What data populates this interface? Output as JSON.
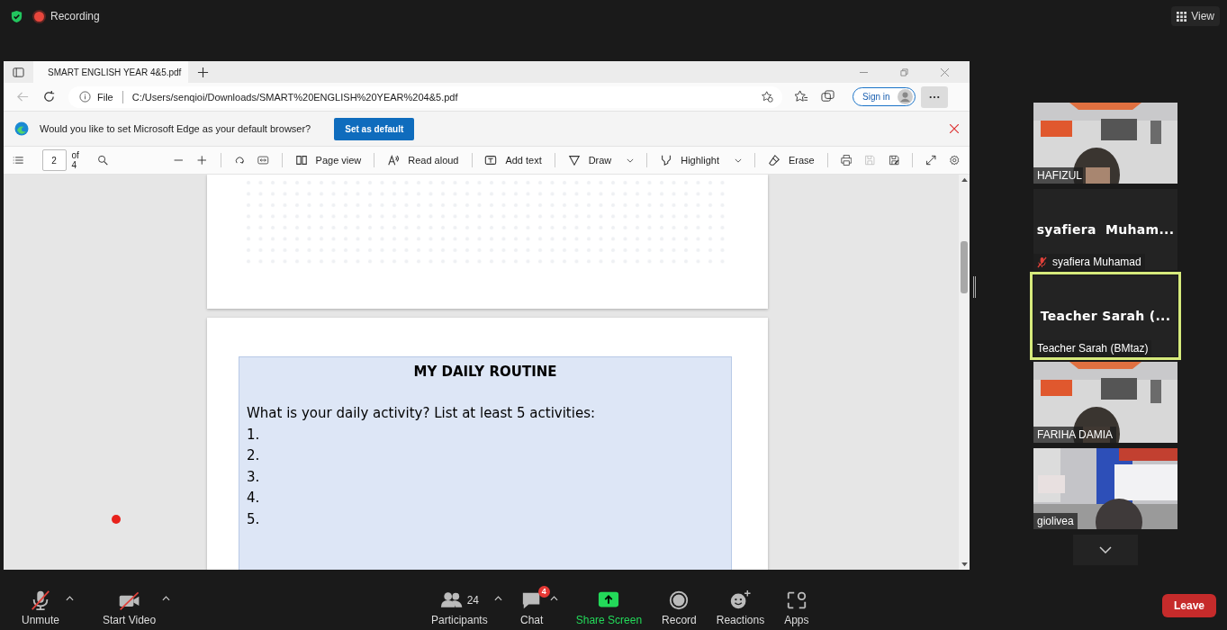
{
  "meeting_bar": {
    "recording_label": "Recording",
    "view_label": "View"
  },
  "browser": {
    "tab_title": "SMART ENGLISH YEAR 4&5.pdf",
    "scheme": "File",
    "address": "C:/Users/senqioi/Downloads/SMART%20ENGLISH%20YEAR%204&5.pdf",
    "sign_in": "Sign in",
    "banner": {
      "message": "Would you like to set Microsoft Edge as your default browser?",
      "button": "Set as default"
    },
    "pdf_toolbar": {
      "page": "2",
      "page_count": "of 4",
      "tools": [
        {
          "kind": "page-view",
          "label": "Page view",
          "has_menu": false
        },
        {
          "kind": "read-aloud",
          "label": "Read aloud",
          "has_menu": false
        },
        {
          "kind": "add-text",
          "label": "Add text",
          "has_menu": false
        },
        {
          "kind": "draw",
          "label": "Draw",
          "has_menu": true
        },
        {
          "kind": "highlight",
          "label": "Highlight",
          "has_menu": true
        },
        {
          "kind": "erase",
          "label": "Erase",
          "has_menu": false
        }
      ]
    },
    "document": {
      "heading": "MY DAILY ROUTINE",
      "prompt": "What is your daily activity? List at least 5 activities:",
      "items": [
        "1.",
        "2.",
        "3.",
        "4.",
        "5."
      ]
    }
  },
  "participants": [
    {
      "name": "HAFIZUL",
      "kind": "video",
      "muted": false,
      "speaking": false
    },
    {
      "name": "syafiera Muhamad",
      "display_name": "syafiera  Muham...",
      "kind": "avatar",
      "muted": true,
      "speaking": false
    },
    {
      "name": "Teacher Sarah (BMtaz)",
      "display_name": "Teacher Sarah (...",
      "kind": "avatar",
      "muted": false,
      "speaking": true
    },
    {
      "name": "FARIHA DAMIA",
      "kind": "video",
      "muted": false,
      "speaking": false
    },
    {
      "name": "giolivea",
      "kind": "video",
      "muted": false,
      "speaking": false
    }
  ],
  "toolbar": [
    {
      "kind": "mic-off",
      "label": "Unmute",
      "has_menu": true
    },
    {
      "kind": "video-off",
      "label": "Start Video",
      "has_menu": true
    },
    {
      "kind": "participants",
      "label": "Participants",
      "count": "24",
      "has_menu": true
    },
    {
      "kind": "chat",
      "label": "Chat",
      "badge": "4",
      "has_menu": true
    },
    {
      "kind": "share",
      "label": "Share Screen",
      "has_menu": false
    },
    {
      "kind": "record",
      "label": "Record",
      "has_menu": false
    },
    {
      "kind": "reactions",
      "label": "Reactions",
      "has_menu": false
    },
    {
      "kind": "apps",
      "label": "Apps",
      "has_menu": false
    }
  ],
  "leave_label": "Leave"
}
